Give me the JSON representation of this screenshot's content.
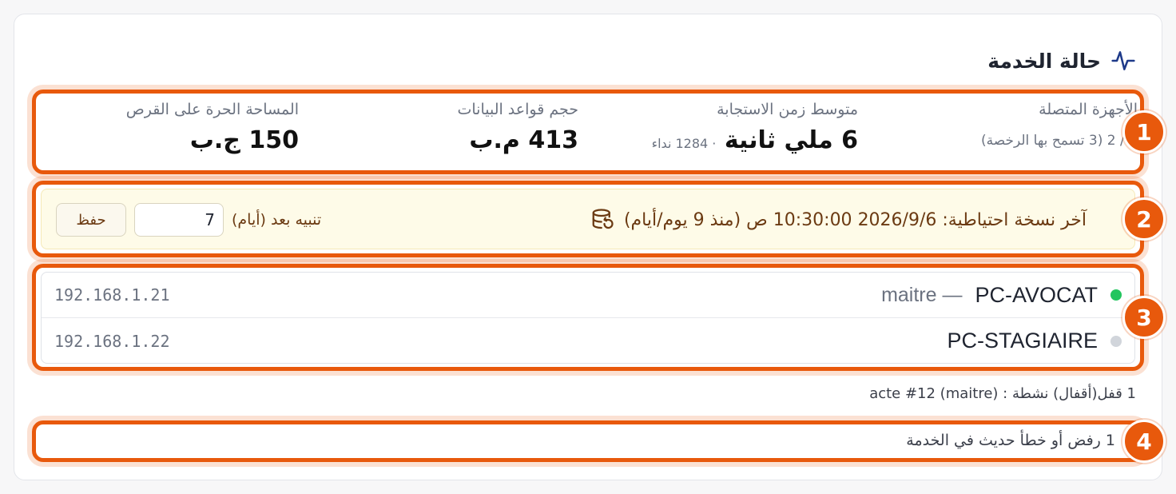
{
  "header": {
    "title": "حالة الخدمة",
    "icon": "pulse-icon"
  },
  "stats": {
    "connected_devices": {
      "label": "الأجهزة المتصلة",
      "value": "2 / 2 (3 تسمح بها الرخصة)"
    },
    "avg_response": {
      "label": "متوسط زمن الاستجابة",
      "value": "6 ملي ثانية",
      "sub": "· 1284 نداء"
    },
    "db_size": {
      "label": "حجم قواعد البيانات",
      "value": "413 م.ب"
    },
    "free_disk": {
      "label": "المساحة الحرة على القرص",
      "value": "150 ج.ب"
    }
  },
  "backup": {
    "text": "آخر نسخة احتياطية: 2026/9/6 10:30:00 ص (منذ 9 يوم/أيام)",
    "alert_label": "تنبيه بعد (أيام)",
    "alert_days": "7",
    "save_label": "حفظ",
    "icon": "database-restore-icon"
  },
  "devices": [
    {
      "name": "PC-AVOCAT",
      "role": "maitre —",
      "ip": "192.168.1.21",
      "status_color": "#22c55e"
    },
    {
      "name": "PC-STAGIAIRE",
      "role": "",
      "ip": "192.168.1.22",
      "status_color": "#d1d5db"
    }
  ],
  "locks": {
    "text": "1 قفل(أقفال) نشطة : acte #12 (maitre)"
  },
  "errors": {
    "text": "1 رفض أو خطأ حديث في الخدمة"
  },
  "annotations": [
    "1",
    "2",
    "3",
    "4"
  ],
  "colors": {
    "accent": "#e8590c",
    "backup_bg": "#fefbe8",
    "online": "#22c55e",
    "offline": "#d1d5db"
  }
}
